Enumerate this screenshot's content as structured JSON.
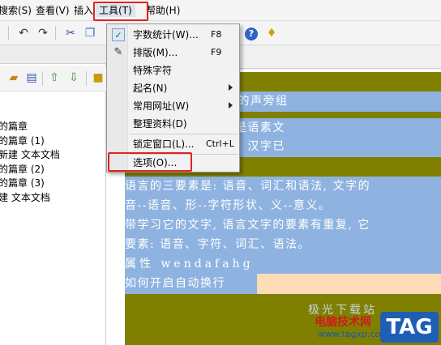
{
  "menubar": {
    "items": [
      {
        "label": "搜索(S)"
      },
      {
        "label": "查看(V)"
      },
      {
        "label": "插入"
      },
      {
        "label": "工具(T)"
      },
      {
        "label": "帮助(H)"
      }
    ]
  },
  "toolbar": {
    "icons": [
      "undo-icon",
      "redo-icon",
      "cut-icon",
      "copy-icon",
      "help-icon",
      "tip-icon"
    ]
  },
  "left_panel": {
    "tree_items": [
      {
        "label": "的篇章"
      },
      {
        "label": "的篇章 (1)"
      },
      {
        "label": "新建 文本文档"
      },
      {
        "label": "的篇章 (2)"
      },
      {
        "label": "的篇章 (3)"
      },
      {
        "label": "建 文本文档"
      }
    ]
  },
  "tools_menu": {
    "items": [
      {
        "label": "字数统计(W)...",
        "shortcut": "F8",
        "icon": "word-count-icon"
      },
      {
        "label": "排版(M)...",
        "shortcut": "F9",
        "icon": "typeset-icon"
      },
      {
        "label": "特殊字符",
        "shortcut": ""
      },
      {
        "label": "起名(N)",
        "shortcut": ""
      },
      {
        "label": "常用网址(W)",
        "shortcut": ""
      },
      {
        "label": "整理资料(D)",
        "shortcut": ""
      },
      {
        "label": "锁定窗口(L)...",
        "shortcut": "Ctrl+L"
      },
      {
        "label": "选项(O)...",
        "shortcut": ""
      }
    ]
  },
  "editor": {
    "lines": [
      "义的象形符号和表音的声旁组",
      "的意音文字, 汉字也是语素文",
      "字进化成的意音文字, 汉字已",
      "语言的三要素是: 语音、词汇和语法, 文字的",
      "音--语音、形--字符形状、义--意义。",
      "带学习它的文字, 语言文字的要素有重复, 它",
      "要素: 语音、字符、词汇、语法。",
      "属性 wendafahg",
      "如何开启自动换行"
    ],
    "background_color": "#808000",
    "selection_color": "#8fb3e0"
  },
  "watermark": {
    "title": "电脑技术网",
    "url": "www.tagxp.com",
    "badge": "TAG",
    "faint": "极光下载站"
  }
}
